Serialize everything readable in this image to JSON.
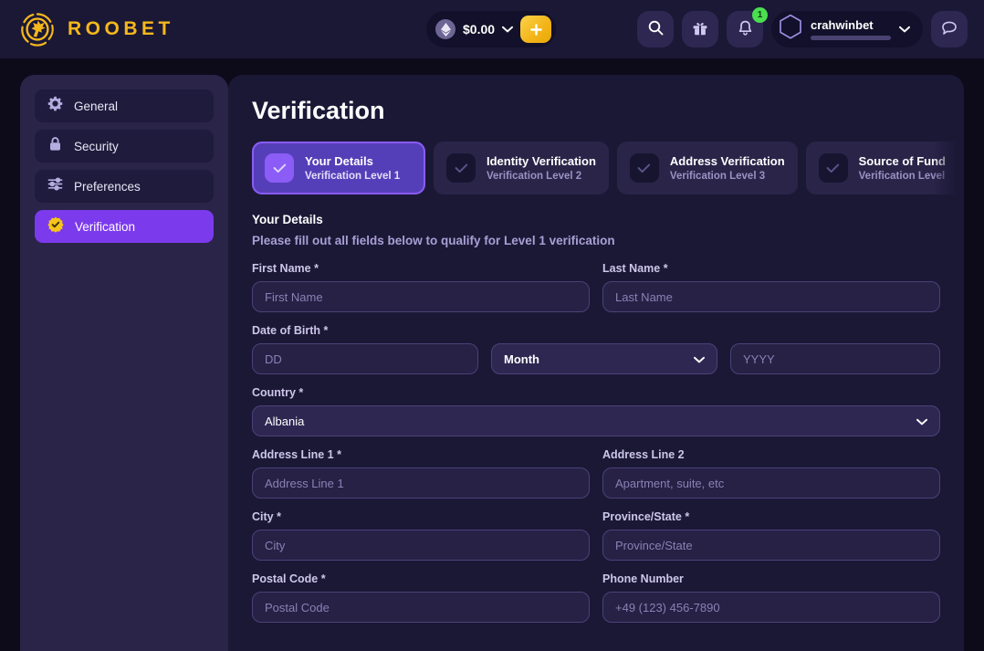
{
  "header": {
    "brand_name": "ROOBET",
    "brand_logo_icon": "roobet-kangaroo-logo",
    "balance": {
      "coin_icon": "ethereum-icon",
      "amount": "$0.00",
      "chevron_icon": "chevron-down-icon",
      "deposit_icon": "plus-icon"
    },
    "actions": [
      {
        "name": "search-button",
        "icon": "search-icon"
      },
      {
        "name": "rewards-button",
        "icon": "gift-icon"
      },
      {
        "name": "notifications-button",
        "icon": "bell-icon",
        "badge": "1"
      }
    ],
    "user": {
      "avatar_icon": "hexagon-avatar-icon",
      "username": "crahwinbet",
      "chevron_icon": "chevron-down-icon"
    },
    "chat": {
      "name": "chat-button",
      "icon": "chat-bubble-icon"
    }
  },
  "sidebar": {
    "items": [
      {
        "label": "General",
        "icon": "gear-icon",
        "active": false
      },
      {
        "label": "Security",
        "icon": "lock-icon",
        "active": false
      },
      {
        "label": "Preferences",
        "icon": "sliders-icon",
        "active": false
      },
      {
        "label": "Verification",
        "icon": "check-badge-icon",
        "active": true
      }
    ]
  },
  "main": {
    "page_title": "Verification",
    "tabs": [
      {
        "title": "Your Details",
        "sub": "Verification Level 1",
        "active": true
      },
      {
        "title": "Identity Verification",
        "sub": "Verification Level 2",
        "active": false
      },
      {
        "title": "Address Verification",
        "sub": "Verification Level 3",
        "active": false
      },
      {
        "title": "Source of Fund",
        "sub": "Verification Level",
        "active": false
      }
    ],
    "section_title": "Your Details",
    "section_subtitle": "Please fill out all fields below to qualify for Level 1 verification",
    "fields": {
      "first_name": {
        "label": "First Name *",
        "placeholder": "First Name",
        "value": ""
      },
      "last_name": {
        "label": "Last Name *",
        "placeholder": "Last Name",
        "value": ""
      },
      "dob": {
        "label": "Date of Birth *"
      },
      "dob_day": {
        "placeholder": "DD",
        "value": ""
      },
      "dob_month": {
        "value": "Month"
      },
      "dob_year": {
        "placeholder": "YYYY",
        "value": ""
      },
      "country": {
        "label": "Country *",
        "value": "Albania"
      },
      "address1": {
        "label": "Address Line 1 *",
        "placeholder": "Address Line 1",
        "value": ""
      },
      "address2": {
        "label": "Address Line 2",
        "placeholder": "Apartment, suite, etc",
        "value": ""
      },
      "city": {
        "label": "City *",
        "placeholder": "City",
        "value": ""
      },
      "province": {
        "label": "Province/State *",
        "placeholder": "Province/State",
        "value": ""
      },
      "postal_code": {
        "label": "Postal Code *",
        "placeholder": "Postal Code",
        "value": ""
      },
      "phone": {
        "label": "Phone Number",
        "placeholder": "+49 (123) 456-7890",
        "value": ""
      }
    }
  },
  "colors": {
    "brand_yellow": "#f5b81c",
    "accent_purple": "#7c3aed",
    "tab_active": "#553fb8",
    "badge_green": "#4ade50",
    "page_bg": "#0d0b1a",
    "panel_bg": "#1b1836",
    "sidebar_bg": "#2a2448"
  }
}
